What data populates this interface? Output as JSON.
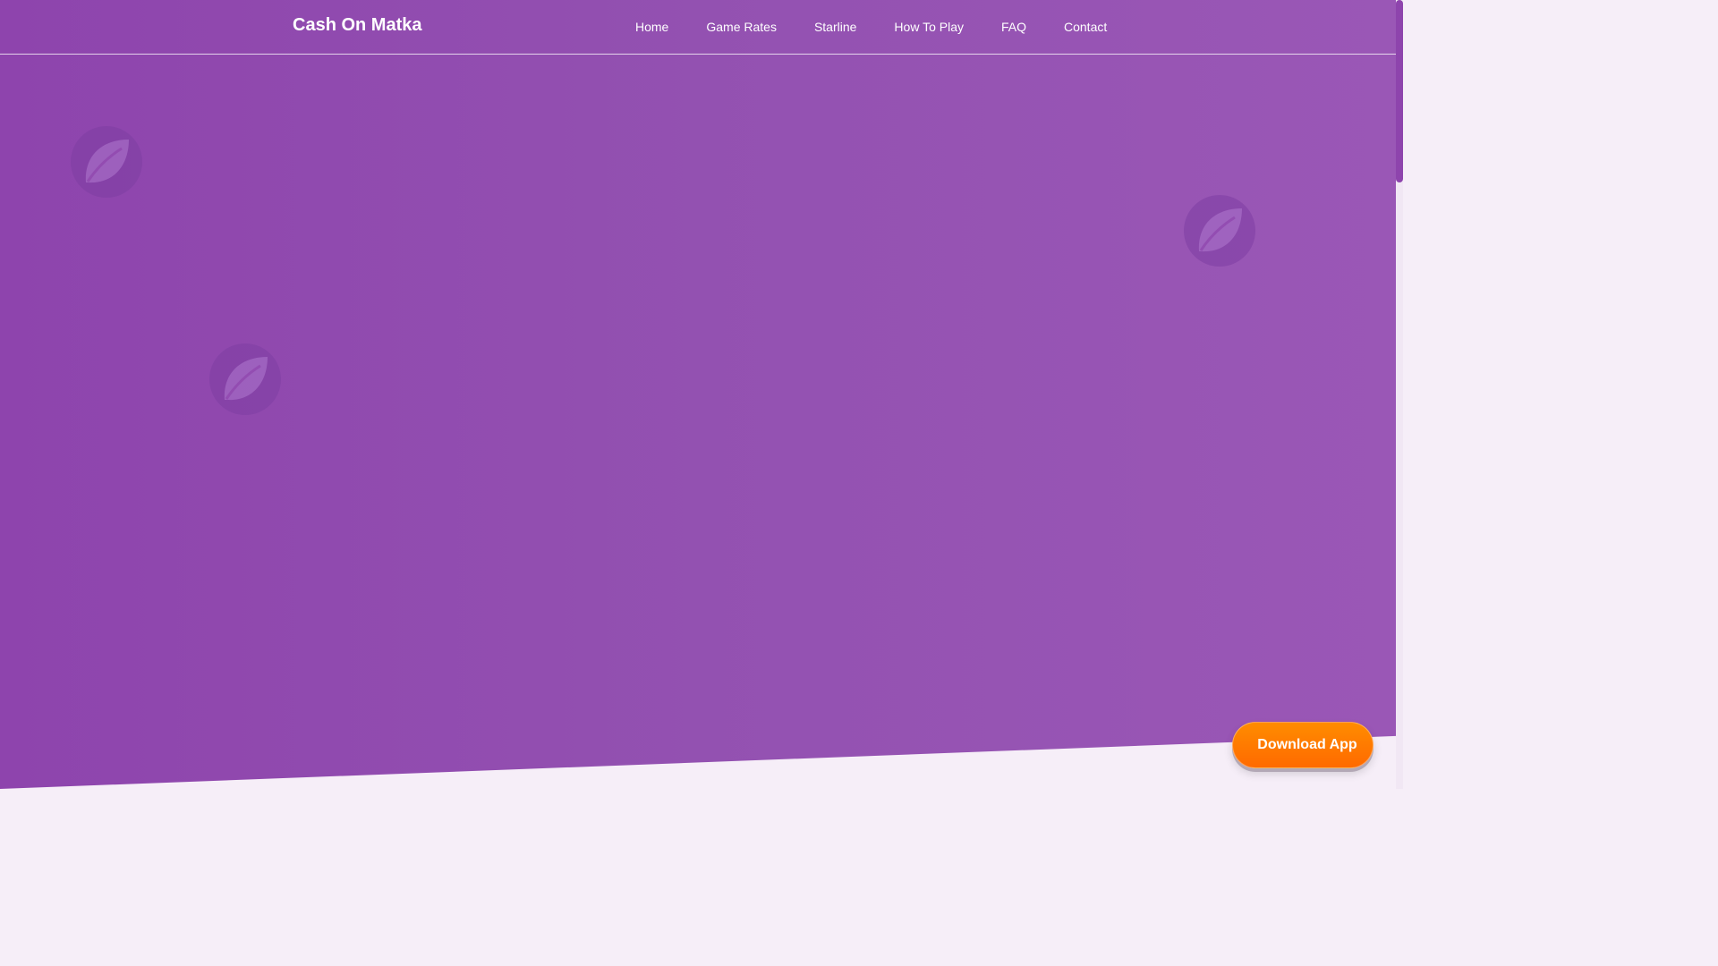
{
  "header": {
    "brand": "Cash On Matka",
    "nav": [
      {
        "label": "Home"
      },
      {
        "label": "Game Rates"
      },
      {
        "label": "Starline"
      },
      {
        "label": "How To Play"
      },
      {
        "label": "FAQ"
      },
      {
        "label": "Contact"
      }
    ]
  },
  "decorations": {
    "icon": "leaf-icon",
    "count": 3
  },
  "floating": {
    "download_label": "Download App"
  },
  "colors": {
    "hero_purple": "#8e44ad",
    "page_bg": "#f6eef8",
    "button_orange": "#ff7a00",
    "text": "#ffffff"
  }
}
